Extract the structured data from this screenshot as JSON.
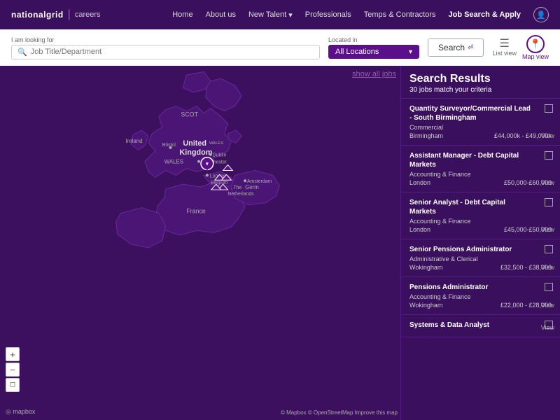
{
  "brand": {
    "logo": "nationalgrid",
    "separator": "|",
    "product": "careers"
  },
  "nav": {
    "links": [
      {
        "id": "home",
        "label": "Home"
      },
      {
        "id": "about",
        "label": "About us"
      },
      {
        "id": "new-talent",
        "label": "New Talent",
        "has_dropdown": true
      },
      {
        "id": "professionals",
        "label": "Professionals"
      },
      {
        "id": "temps",
        "label": "Temps & Contractors"
      },
      {
        "id": "job-search",
        "label": "Job Search & Apply",
        "active": true
      }
    ]
  },
  "search": {
    "i_am_looking_for_label": "I am looking for",
    "job_title_placeholder": "Job Title/Department",
    "located_in_label": "Located in",
    "location_value": "All Locations",
    "search_button_label": "Search",
    "list_view_label": "List view",
    "map_view_label": "Map view"
  },
  "map": {
    "show_all_jobs_label": "show all jobs",
    "zoom_in": "+",
    "zoom_out": "−",
    "zoom_extra": "◻",
    "attribution": "© Mapbox © OpenStreetMap  Improve this map",
    "mapbox_logo": "◎ mapbox"
  },
  "results": {
    "title": "Search Results",
    "count_text": "jobs match your criteria",
    "count": "30",
    "jobs": [
      {
        "title": "Quantity Surveyor/Commercial Lead - South Birmingham",
        "department": "Commercial",
        "location": "Birmingham",
        "salary": "£44,000k - £49,000k",
        "view_label": "View"
      },
      {
        "title": "Assistant Manager - Debt Capital Markets",
        "department": "Accounting & Finance",
        "location": "London",
        "salary": "£50,000-£60,000",
        "view_label": "View"
      },
      {
        "title": "Senior Analyst - Debt Capital Markets",
        "department": "Accounting & Finance",
        "location": "London",
        "salary": "£45,000-£50,000",
        "view_label": "View"
      },
      {
        "title": "Senior Pensions Administrator",
        "department": "Administrative & Clerical",
        "location": "Wokingham",
        "salary": "£32,500 - £38,000",
        "view_label": "View"
      },
      {
        "title": "Pensions Administrator",
        "department": "Accounting & Finance",
        "location": "Wokingham",
        "salary": "£22,000 - £28,000",
        "view_label": "View"
      },
      {
        "title": "Systems & Data Analyst",
        "department": "",
        "location": "",
        "salary": "",
        "view_label": "View"
      }
    ]
  }
}
